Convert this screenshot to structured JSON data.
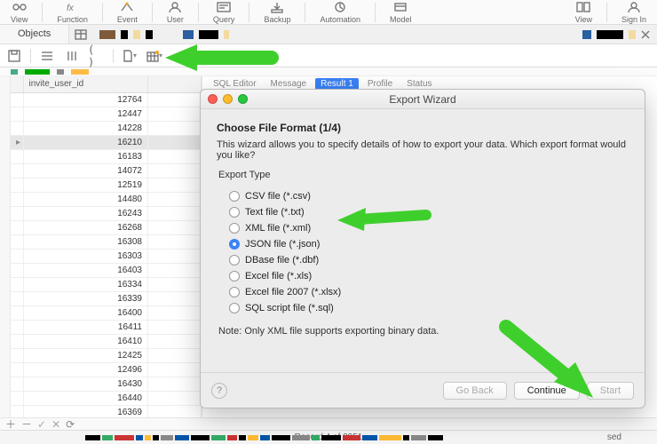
{
  "ribbon": {
    "tools": [
      {
        "label": "View"
      },
      {
        "label": "Function"
      },
      {
        "label": "Event"
      },
      {
        "label": "User"
      },
      {
        "label": "Query"
      },
      {
        "label": "Backup"
      },
      {
        "label": "Automation"
      },
      {
        "label": "Model"
      }
    ],
    "right": [
      {
        "label": "View"
      },
      {
        "label": "Sign In"
      }
    ]
  },
  "tabs": {
    "objects": "Objects"
  },
  "grid": {
    "column": "invite_user_id",
    "rows": [
      "12764",
      "12447",
      "14228",
      "16210",
      "16183",
      "14072",
      "12519",
      "14480",
      "16243",
      "16268",
      "16308",
      "16303",
      "16403",
      "16334",
      "16339",
      "16400",
      "16411",
      "16410",
      "12425",
      "12496",
      "16430",
      "16440",
      "16369",
      ""
    ],
    "selected_index": 3
  },
  "modal": {
    "title": "Export Wizard",
    "heading": "Choose File Format (1/4)",
    "description": "This wizard allows you to specify details of how to export your data. Which export format would you like?",
    "section": "Export Type",
    "options": [
      "CSV file (*.csv)",
      "Text file (*.txt)",
      "XML file (*.xml)",
      "JSON file (*.json)",
      "DBase file (*.dbf)",
      "Excel file (*.xls)",
      "Excel file 2007 (*.xlsx)",
      "SQL script file (*.sql)"
    ],
    "selected_option_index": 3,
    "note": "Note: Only XML file supports exporting binary data.",
    "buttons": {
      "back": "Go Back",
      "continue": "Continue",
      "start": "Start"
    }
  },
  "behind_tabs": {
    "items": [
      "SQL Editor",
      "Message",
      "Result 1",
      "Profile",
      "Status"
    ]
  },
  "status": {
    "record": "Record 4 of 2951",
    "sed": "sed"
  }
}
